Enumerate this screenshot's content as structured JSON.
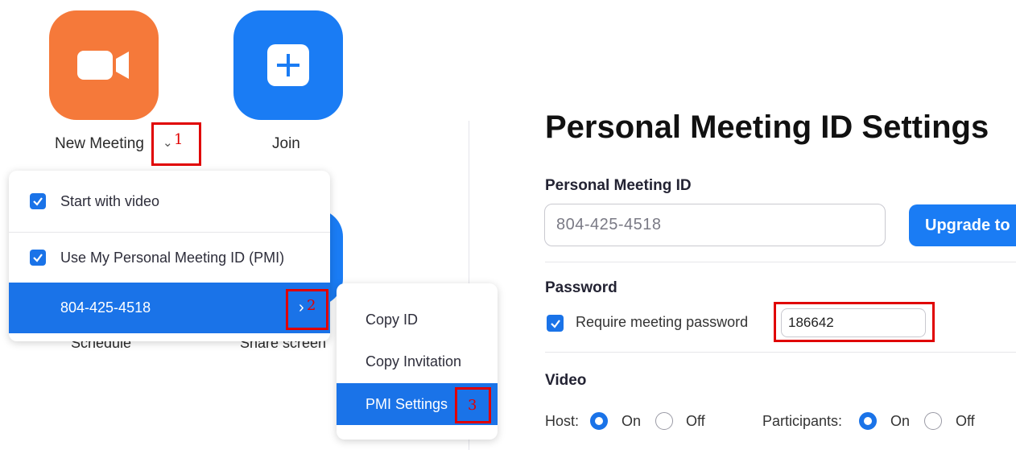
{
  "home": {
    "new_meeting_label": "New Meeting",
    "join_label": "Join",
    "schedule_label": "Schedule",
    "share_screen_label": "Share screen"
  },
  "new_meeting_menu": {
    "items": [
      {
        "label": "Start with video",
        "checked": true
      },
      {
        "label": "Use My Personal Meeting ID (PMI)",
        "checked": true
      }
    ],
    "pmi_number": "804-425-4518"
  },
  "pmi_submenu": {
    "items": [
      "Copy ID",
      "Copy Invitation",
      "PMI Settings"
    ]
  },
  "annotations": [
    "1",
    "2",
    "3"
  ],
  "settings": {
    "title": "Personal Meeting ID Settings",
    "pmi_label": "Personal Meeting ID",
    "pmi_value": "804-425-4518",
    "upgrade_button": "Upgrade to",
    "password_label": "Password",
    "require_password_label": "Require meeting password",
    "password_value": "186642",
    "video_label": "Video",
    "host_label": "Host:",
    "participants_label": "Participants:",
    "on_label": "On",
    "off_label": "Off"
  },
  "colors": {
    "orange": "#f5793a",
    "blue": "#1a7cf4",
    "highlight": "#e00000"
  }
}
